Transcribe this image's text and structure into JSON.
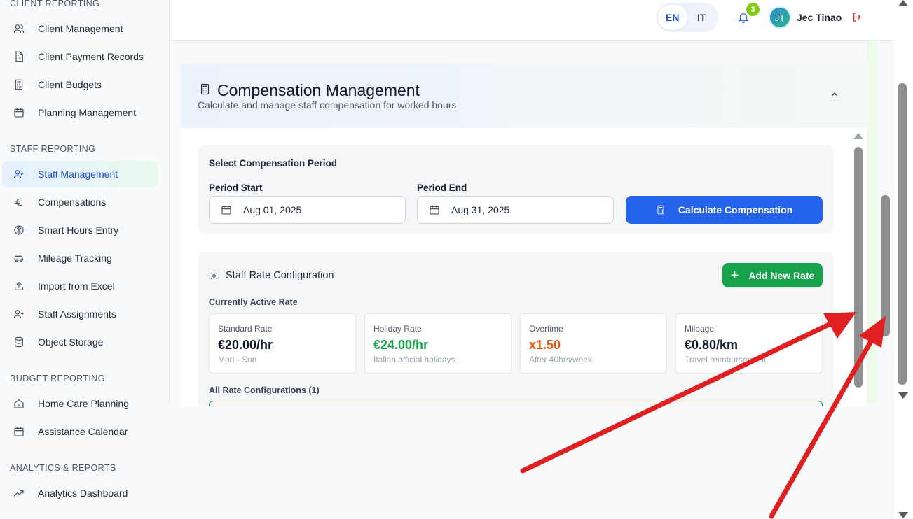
{
  "sidebar": {
    "sections": {
      "client": "CLIENT REPORTING",
      "staff": "STAFF REPORTING",
      "budget": "BUDGET REPORTING",
      "analytics": "ANALYTICS & REPORTS"
    },
    "items": [
      {
        "label": "Client Management",
        "icon": "users-icon"
      },
      {
        "label": "Client Payment Records",
        "icon": "document-icon"
      },
      {
        "label": "Client Budgets",
        "icon": "calculator-icon"
      },
      {
        "label": "Planning Management",
        "icon": "calendar-icon"
      },
      {
        "label": "Staff Management",
        "icon": "user-check-icon",
        "active": true
      },
      {
        "label": "Compensations",
        "icon": "euro-icon"
      },
      {
        "label": "Smart Hours Entry",
        "icon": "brain-icon"
      },
      {
        "label": "Mileage Tracking",
        "icon": "car-icon"
      },
      {
        "label": "Import from Excel",
        "icon": "upload-icon"
      },
      {
        "label": "Staff Assignments",
        "icon": "user-plus-icon"
      },
      {
        "label": "Object Storage",
        "icon": "database-icon"
      },
      {
        "label": "Home Care Planning",
        "icon": "home-icon"
      },
      {
        "label": "Assistance Calendar",
        "icon": "calendar-icon"
      },
      {
        "label": "Analytics Dashboard",
        "icon": "trending-up-icon"
      }
    ]
  },
  "header": {
    "languages": [
      "EN",
      "IT"
    ],
    "selected_language": "EN",
    "notification_count": "3",
    "user_initials": "JT",
    "user_name": "Jec Tinao"
  },
  "card": {
    "title": "Compensation Management",
    "subtitle": "Calculate and manage staff compensation for worked hours"
  },
  "period": {
    "title": "Select Compensation Period",
    "start_label": "Period Start",
    "start_value": "Aug 01, 2025",
    "end_label": "Period End",
    "end_value": "Aug 31, 2025",
    "calculate_label": "Calculate Compensation"
  },
  "rates": {
    "title": "Staff Rate Configuration",
    "add_label": "Add New Rate",
    "active_label": "Currently Active Rate",
    "cards": [
      {
        "label": "Standard Rate",
        "value": "€20.00/hr",
        "sub": "Mon - Sun",
        "color": "#111827"
      },
      {
        "label": "Holiday Rate",
        "value": "€24.00/hr",
        "sub": "Italian official holidays",
        "color": "#16a34a"
      },
      {
        "label": "Overtime",
        "value": "x1.50",
        "sub": "After 40hrs/week",
        "color": "#ea580c"
      },
      {
        "label": "Mileage",
        "value": "€0.80/km",
        "sub": "Travel reimbursement",
        "color": "#111827"
      }
    ],
    "all_label": "All Rate Configurations (1)"
  },
  "colors": {
    "primary": "#2563eb",
    "success": "#16a34a",
    "annotation_arrow": "#e02020"
  }
}
